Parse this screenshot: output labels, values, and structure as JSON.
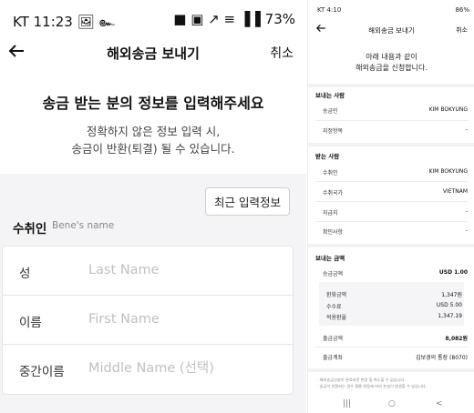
{
  "left": {
    "status_left": "KT 11:23",
    "status_icons": "🖼 ๛",
    "status_right": "■ ▣ ↗ ≡ ▐▐ 73%",
    "back_icon": "left-arrow",
    "title": "해외송금 보내기",
    "cancel": "취소",
    "intro_heading": "송금 받는 분의 정보를 입력해주세요",
    "intro_line1": "정확하지 않은 정보 입력 시,",
    "intro_line2": "송금이 반환(퇴결) 될 수 있습니다.",
    "recent_button": "최근 입력정보",
    "receiver_label": "수취인",
    "receiver_sub": "Bene's name",
    "fields": [
      {
        "label": "성",
        "placeholder": "Last Name",
        "value": ""
      },
      {
        "label": "이름",
        "placeholder": "First Name",
        "value": ""
      },
      {
        "label": "중간이름",
        "placeholder": "Middle Name (선택)",
        "value": ""
      }
    ]
  },
  "right": {
    "status_left": "KT 4:10",
    "status_right": "86%",
    "title": "해외송금 보내기",
    "cancel": "취소",
    "intro_line1": "아래 내용과 같이",
    "intro_line2": "해외송금을 신청합니다.",
    "sender": {
      "title": "보내는 사람",
      "rows": [
        {
          "key": "송금인",
          "value": "KIM BOKYUNG"
        },
        {
          "key": "지정항목",
          "value": "-"
        }
      ]
    },
    "receiver": {
      "title": "받는 사람",
      "rows": [
        {
          "key": "수취인",
          "value": "KIM BOKYUNG"
        },
        {
          "key": "수취국가",
          "value": "VIETNAM"
        },
        {
          "key": "지급지",
          "value": "-"
        },
        {
          "key": "확인사항",
          "value": "-"
        }
      ]
    },
    "amount": {
      "title": "보내는 금액",
      "send_key": "송금금액",
      "send_value": "USD 1.00",
      "details": [
        {
          "key": "환화금액",
          "value": "1,347원"
        },
        {
          "key": "수수료",
          "value": "USD 5.00"
        },
        {
          "key": "적용환율",
          "value": "1,347.19"
        }
      ],
      "withdraw_key": "출금금액",
      "withdraw_value": "8,082원",
      "account_key": "출금계좌",
      "account_value": "김보경의 통장 (8070)"
    },
    "notes": [
      "· 해외송금신청이 완료되면 변경 및 취소할 수 없습니다.",
      "· 송금이 반환되는 경우 환율 변동에 따라 손실이 발생할 수 있습니다."
    ],
    "nav": {
      "recents": "|||",
      "home": "○",
      "back": "<"
    }
  }
}
